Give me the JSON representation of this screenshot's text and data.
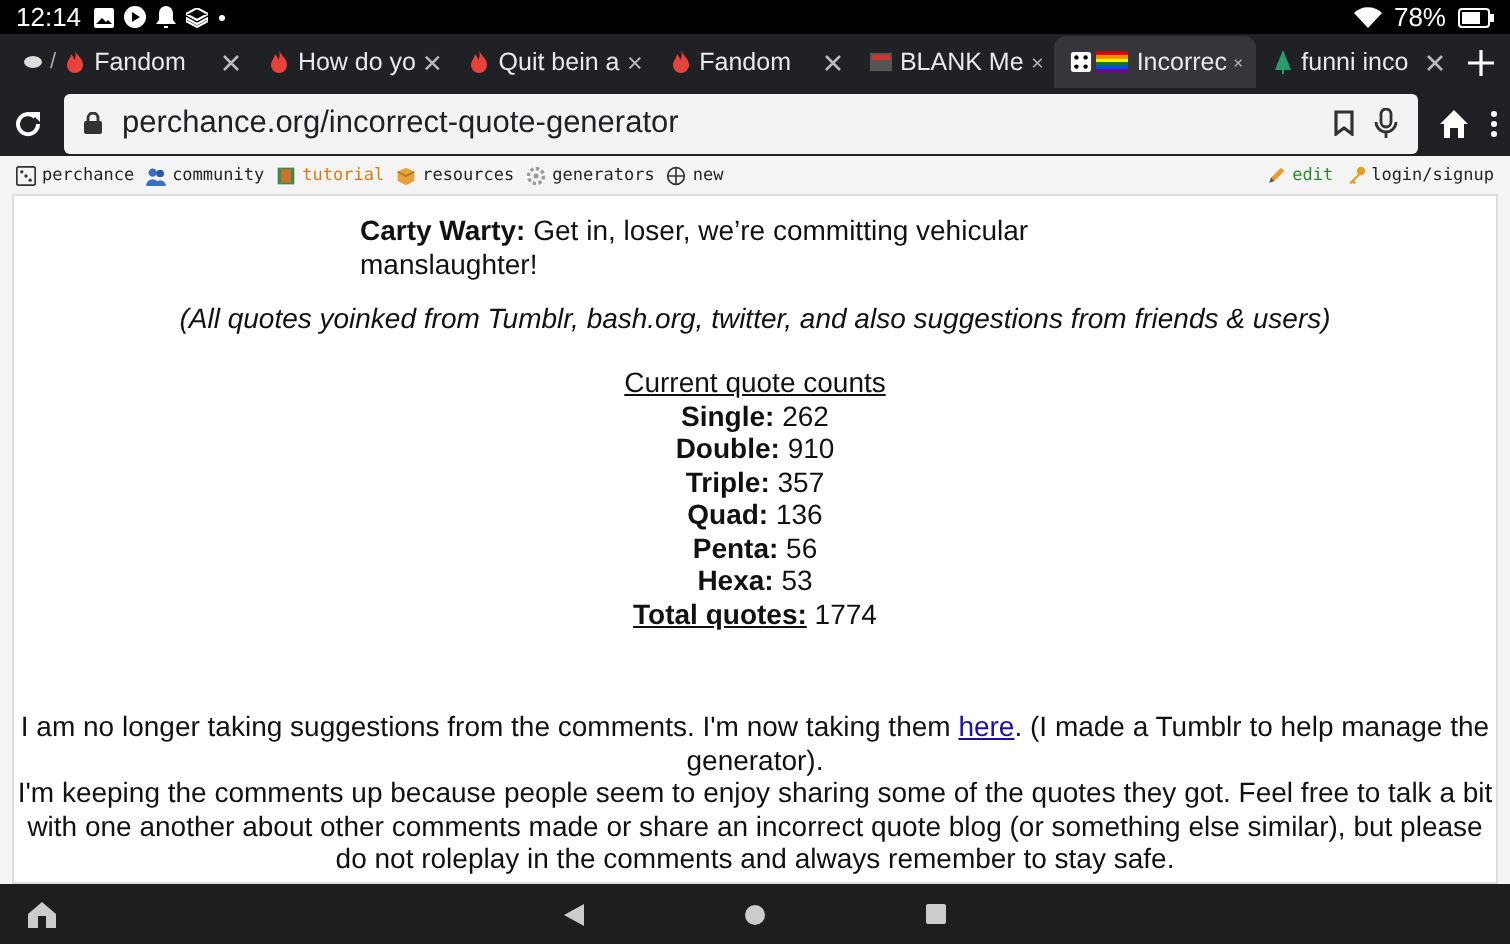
{
  "status_bar": {
    "time": "12:14",
    "battery": "78%"
  },
  "tabs": [
    {
      "prefix": "/",
      "title": "Fandom",
      "kind": "flame",
      "selected": false
    },
    {
      "title": "How do yo",
      "kind": "flame",
      "selected": false
    },
    {
      "title": "Quit bein a",
      "kind": "flame",
      "selected": false
    },
    {
      "title": "Fandom",
      "kind": "flame",
      "selected": false
    },
    {
      "title": "BLANK Me",
      "kind": "meme",
      "selected": false
    },
    {
      "title": "Incorrec",
      "kind": "dice",
      "selected": true
    },
    {
      "title": "funni inco",
      "kind": "tree",
      "selected": false
    }
  ],
  "address_bar": {
    "url": "perchance.org/incorrect-quote-generator"
  },
  "site_nav": {
    "left": [
      {
        "label": "perchance",
        "kind": "dice",
        "color": "#222222"
      },
      {
        "label": "community",
        "kind": "people",
        "color": "#222222"
      },
      {
        "label": "tutorial",
        "kind": "book",
        "color": "#e07a10"
      },
      {
        "label": "resources",
        "kind": "box",
        "color": "#222222"
      },
      {
        "label": "generators",
        "kind": "gear",
        "color": "#222222"
      },
      {
        "label": "new",
        "kind": "plus",
        "color": "#222222"
      }
    ],
    "right": [
      {
        "label": "edit",
        "kind": "pencil",
        "color": "#2a8a2a"
      },
      {
        "label": "login/signup",
        "kind": "key",
        "color": "#222222"
      }
    ]
  },
  "quote": {
    "speaker": "Carty Warty:",
    "text": "Get in, loser, we’re committing vehicular manslaughter!"
  },
  "source_note": "(All quotes yoinked from Tumblr, bash.org, twitter, and also suggestions from friends & users)",
  "counts": {
    "heading": "Current quote counts",
    "rows": [
      {
        "label": "Single:",
        "value": "262"
      },
      {
        "label": "Double:",
        "value": "910"
      },
      {
        "label": "Triple:",
        "value": "357"
      },
      {
        "label": "Quad:",
        "value": "136"
      },
      {
        "label": "Penta:",
        "value": "56"
      },
      {
        "label": "Hexa:",
        "value": "53"
      }
    ],
    "total": {
      "label": "Total quotes:",
      "value": "1774"
    }
  },
  "notice": {
    "before": "I am no longer taking suggestions from the comments. I'm now taking them ",
    "link": "here",
    "after": ". (I made a Tumblr to help manage the generator)."
  },
  "paragraph": "I'm keeping the comments up because people seem to enjoy sharing some of the quotes they got. Feel free to talk a bit with one another about other comments made or share an incorrect quote blog (or something else similar), but please do not roleplay in the comments and always remember to stay safe."
}
